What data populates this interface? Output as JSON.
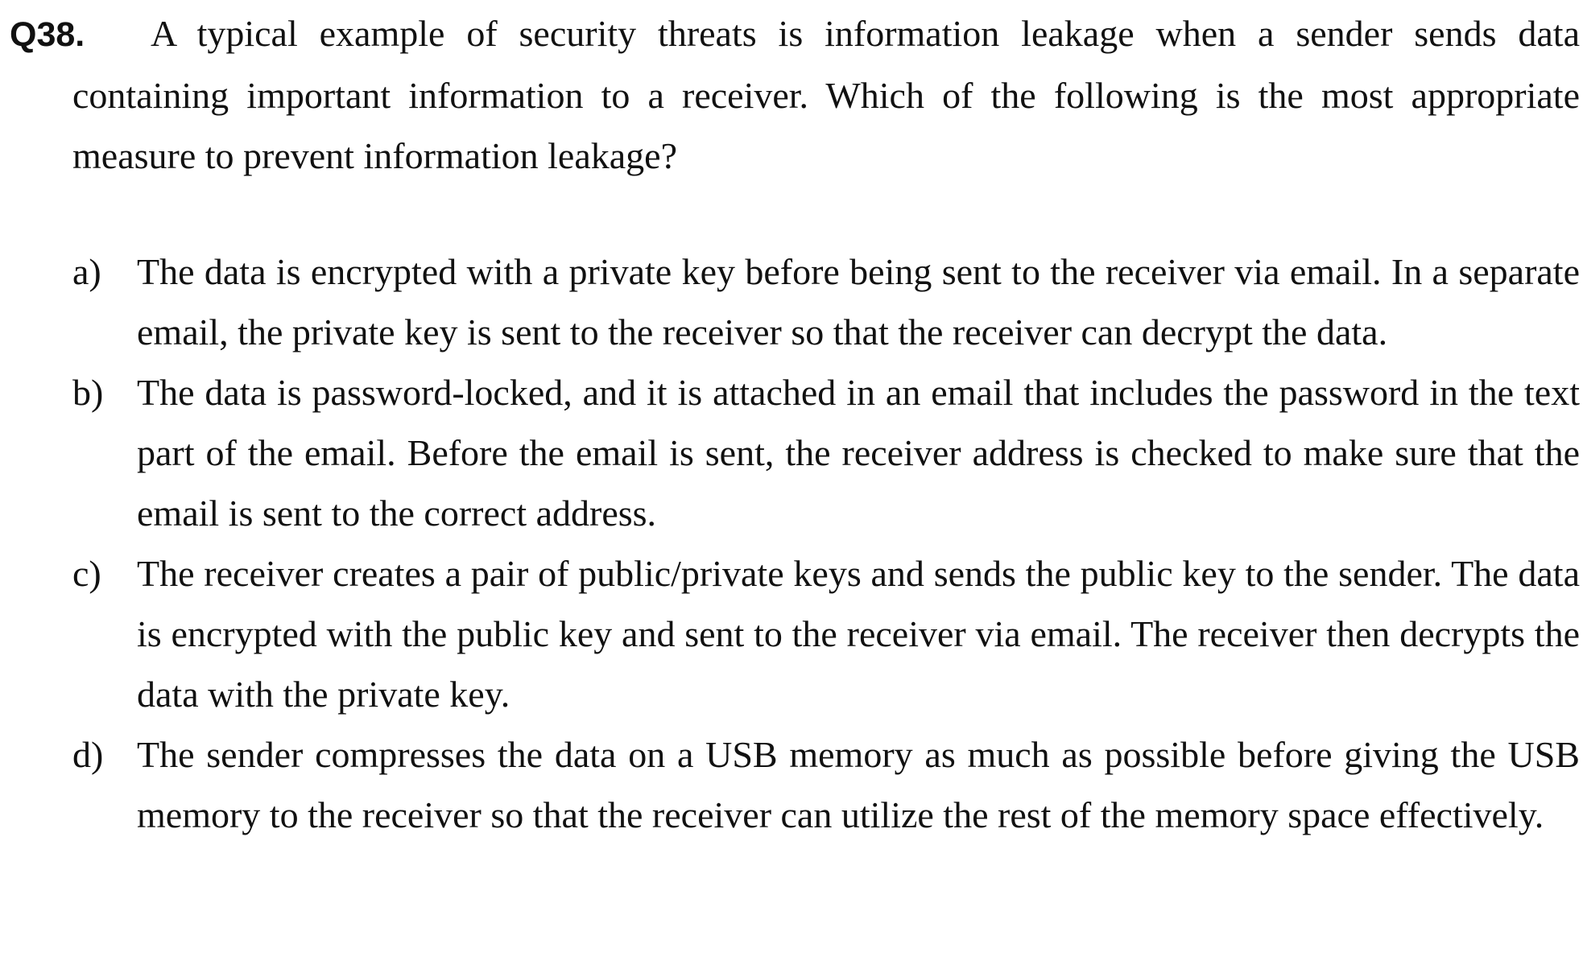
{
  "question": {
    "number": "Q38.",
    "text": "A typical example of security threats is information leakage when a sender sends data containing important information to a receiver. Which of the following is the most appropriate measure to prevent information leakage?"
  },
  "options": [
    {
      "label": "a)",
      "text": "The data is encrypted with a private key before being sent to the receiver via email. In a separate email, the private key is sent to the receiver so that the receiver can decrypt the data."
    },
    {
      "label": "b)",
      "text": "The data is password-locked, and it is attached in an email that includes the password in the text part of the email. Before the email is sent, the receiver address is checked to make sure that the email is sent to the correct address."
    },
    {
      "label": "c)",
      "text": "The receiver creates a pair of public/private keys and sends the public key to the sender. The data is encrypted with the public key and sent to the receiver via email. The receiver then decrypts the data with the private key."
    },
    {
      "label": "d)",
      "text": "The sender compresses the data on a USB memory as much as possible before giving the USB memory to the receiver so that the receiver can utilize the rest of the memory space effectively."
    }
  ]
}
